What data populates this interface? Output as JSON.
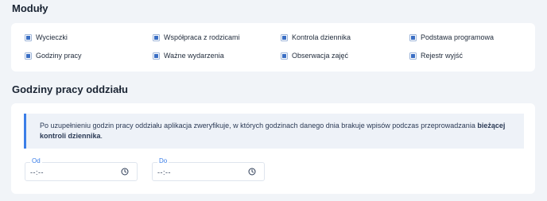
{
  "modules": {
    "title": "Moduły",
    "items": [
      {
        "label": "Wycieczki",
        "checked": true
      },
      {
        "label": "Współpraca z rodzicami",
        "checked": true
      },
      {
        "label": "Kontrola dziennika",
        "checked": true
      },
      {
        "label": "Podstawa programowa",
        "checked": true
      },
      {
        "label": "Godziny pracy",
        "checked": true
      },
      {
        "label": "Ważne wydarzenia",
        "checked": true
      },
      {
        "label": "Obserwacja zajęć",
        "checked": true
      },
      {
        "label": "Rejestr wyjść",
        "checked": true
      }
    ]
  },
  "hours": {
    "title": "Godziny pracy oddziału",
    "info_text_1": "Po uzupełnieniu godzin pracy oddziału aplikacja zweryfikuje, w których godzinach danego dnia brakuje wpisów podczas przeprowadzania ",
    "info_text_bold": "bieżącej kontroli dziennika",
    "info_text_2": ".",
    "from": {
      "label": "Od",
      "value": "--:--"
    },
    "to": {
      "label": "Do",
      "value": "--:--"
    }
  },
  "colors": {
    "accent": "#3b7ee8",
    "checkbox": "#3b6fc4",
    "page_background": "#f1f4f8",
    "info_background": "#eef2f8"
  },
  "icons": {
    "checkbox": "checkbox-checked-icon",
    "time": "clock-icon"
  }
}
